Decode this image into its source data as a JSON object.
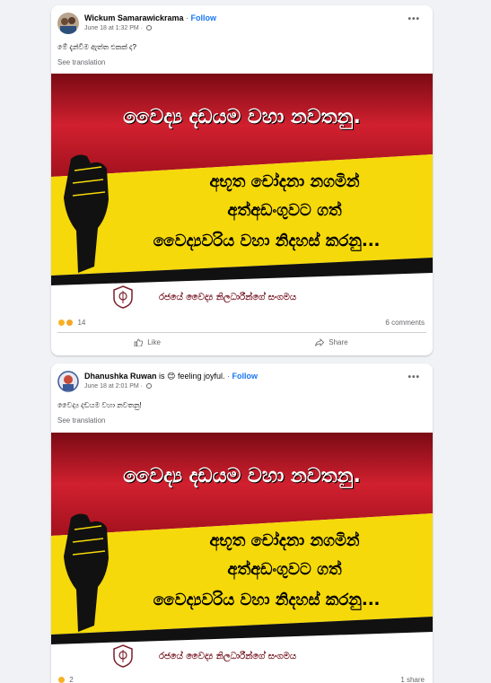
{
  "posts": [
    {
      "author": "Wickum Samarawickrama",
      "separator": "·",
      "follow": "Follow",
      "feeling": "",
      "timestamp": "June 18 at 1:32 PM ·",
      "text": "මේ දැන්වීම ඇත්ත එකක් ද?",
      "see_translation": "See translation",
      "banner": {
        "headline": "වෛද්‍ය දඩයම වහා නවතනු.",
        "line1": "අභූත චෝදනා නගමින්",
        "line2": "අත්අඩංගුවට ගත්",
        "line3": "වෛද්‍යවරිය වහා නිදහස් කරනු...",
        "org": "රජයේ වෛද්‍ය නිලධාරීන්ගේ සංගමය"
      },
      "reaction_count": "14",
      "comments": "6 comments",
      "like": "Like",
      "share": "Share"
    },
    {
      "author": "Dhanushka Ruwan",
      "is_text": "is",
      "feeling": "feeling joyful.",
      "separator": "·",
      "follow": "Follow",
      "timestamp": "June 18 at 2:01 PM ·",
      "text": "වෛද්‍ය දඩයම වහා නවතනු!",
      "see_translation": "See translation",
      "banner": {
        "headline": "වෛද්‍ය දඩයම වහා නවතනු.",
        "line1": "අභූත චෝදනා නගමින්",
        "line2": "අත්අඩංගුවට ගත්",
        "line3": "වෛද්‍යවරිය වහා නිදහස් කරනු...",
        "org": "රජයේ වෛද්‍ය නිලධාරීන්ගේ සංගමය"
      },
      "reaction_count": "2",
      "comments": "1 share"
    }
  ],
  "colors": {
    "background": "#f0f2f5",
    "link": "#1877f2",
    "banner_red": "#c8102e",
    "banner_yellow": "#f5d90a",
    "banner_black": "#111111"
  },
  "icons": {
    "more": "more-options-icon",
    "privacy": "globe-icon",
    "like": "thumbs-up-icon",
    "share": "share-arrow-icon",
    "fist": "raised-fist-icon",
    "emblem": "association-emblem-icon"
  }
}
